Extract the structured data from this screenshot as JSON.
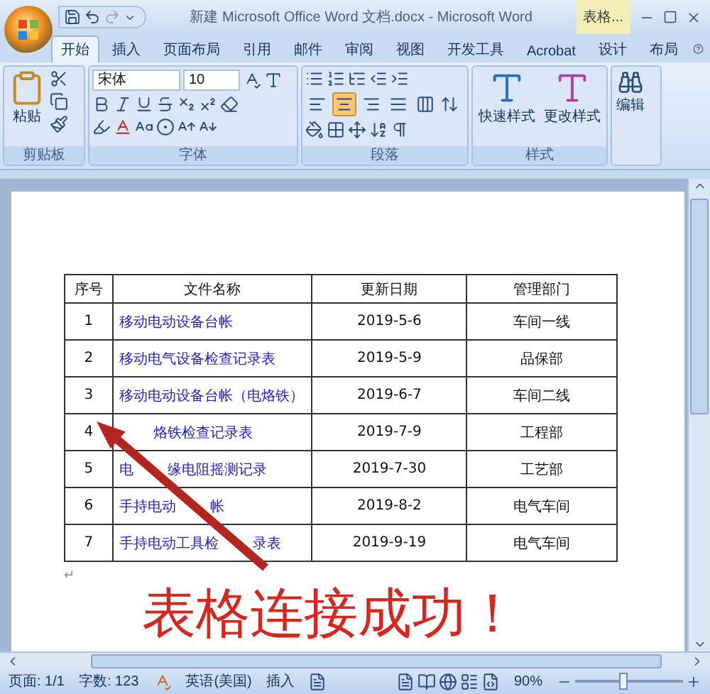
{
  "window": {
    "title": "新建 Microsoft Office Word 文档.docx - Microsoft Word",
    "context_tab": "表格..."
  },
  "tabs": [
    {
      "label": "开始",
      "selected": true
    },
    {
      "label": "插入",
      "selected": false
    },
    {
      "label": "页面布局",
      "selected": false
    },
    {
      "label": "引用",
      "selected": false
    },
    {
      "label": "邮件",
      "selected": false
    },
    {
      "label": "审阅",
      "selected": false
    },
    {
      "label": "视图",
      "selected": false
    },
    {
      "label": "开发工具",
      "selected": false
    },
    {
      "label": "Acrobat",
      "selected": false
    },
    {
      "label": "设计",
      "selected": false
    },
    {
      "label": "布局",
      "selected": false
    }
  ],
  "ribbon": {
    "clipboard": {
      "paste": "粘贴",
      "label": "剪贴板"
    },
    "font": {
      "name": "宋体",
      "size": "10",
      "label": "字体"
    },
    "paragraph": {
      "label": "段落",
      "alignments": [
        {
          "kind": "left",
          "selected": false
        },
        {
          "kind": "center",
          "selected": true
        },
        {
          "kind": "right",
          "selected": false
        },
        {
          "kind": "justify",
          "selected": false
        },
        {
          "kind": "distributed",
          "selected": false
        }
      ]
    },
    "styles": {
      "buttons": [
        "快速样式",
        "更改样式"
      ],
      "label": "样式"
    },
    "editing": {
      "button": "编辑"
    }
  },
  "table": {
    "columns": [
      "序号",
      "文件名称",
      "更新日期",
      "管理部门"
    ],
    "rows": [
      {
        "no": "1",
        "covered_start": false,
        "name_parts": [
          "移动电动设备台帐"
        ],
        "date": "2019-5-6",
        "dept": "车间一线"
      },
      {
        "no": "2",
        "covered_start": false,
        "name_parts": [
          "移动电气设备检查记录表"
        ],
        "date": "2019-5-9",
        "dept": "品保部"
      },
      {
        "no": "3",
        "covered_start": false,
        "name_parts": [
          "移动电动设备台帐（电烙铁）"
        ],
        "date": "2019-6-7",
        "dept": "车间二线"
      },
      {
        "no": "4",
        "covered_start": true,
        "name_parts": [
          "烙铁检查记录表"
        ],
        "date": "2019-7-9",
        "dept": "工程部"
      },
      {
        "no": "5",
        "covered_start": false,
        "name_parts": [
          "电",
          "缘电阻摇测记录"
        ],
        "date": "2019-7-30",
        "dept": "工艺部"
      },
      {
        "no": "6",
        "covered_start": false,
        "name_parts": [
          "手持电动",
          "帐"
        ],
        "date": "2019-8-2",
        "dept": "电气车间"
      },
      {
        "no": "7",
        "covered_start": false,
        "name_parts": [
          "手持电动工具检",
          "录表"
        ],
        "date": "2019-9-19",
        "dept": "电气车间"
      }
    ]
  },
  "paragraph_mark": "↵",
  "annotation": "表格连接成功！",
  "status_bar": {
    "page": "页面: 1/1",
    "words": "字数: 123",
    "language": "英语(美国)",
    "mode": "插入",
    "zoom": "90%",
    "zoom_slider": {
      "level": 0.45
    }
  }
}
